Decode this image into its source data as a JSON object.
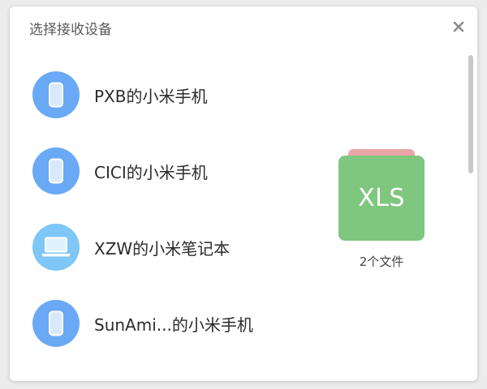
{
  "dialog": {
    "title": "选择接收设备",
    "close_icon": "close-icon"
  },
  "devices": [
    {
      "name": "PXB的小米手机",
      "icon": "phone-icon"
    },
    {
      "name": "CICI的小米手机",
      "icon": "phone-icon"
    },
    {
      "name": "XZW的小米笔记本",
      "icon": "laptop-icon"
    },
    {
      "name": "SunAmi...的小米手机",
      "icon": "phone-icon"
    }
  ],
  "file": {
    "type_label": "XLS",
    "count_label": "2个文件"
  },
  "colors": {
    "phone_avatar": "#6aa9f5",
    "laptop_avatar": "#7ec7f7",
    "file_front": "#7fc67f",
    "file_back": "#e8a6a6"
  }
}
